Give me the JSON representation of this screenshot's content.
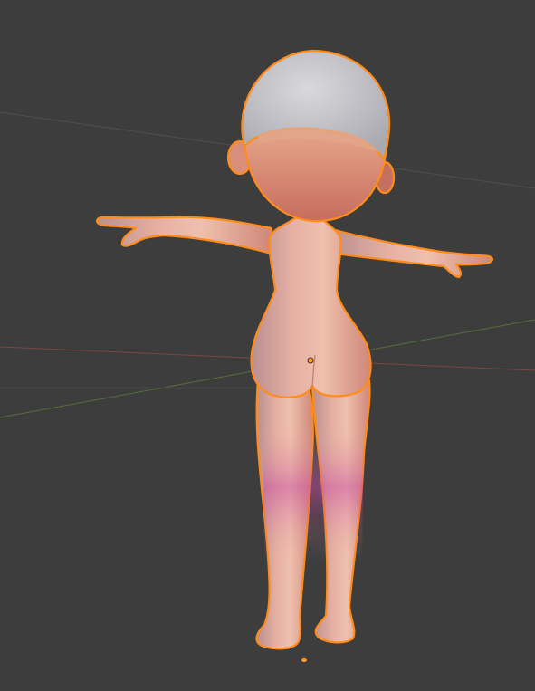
{
  "viewport": {
    "background": "#3d3d3d",
    "axis_colors": {
      "x_axis": "#8a4a4a",
      "y_axis": "#5f7a3e",
      "grid": "#4a4a4a"
    }
  },
  "model": {
    "selected": true,
    "outline_color": "#ff8c1a",
    "skin_base": "#e9b3a3",
    "skin_shadow": "#c06f6a",
    "hair_color": "#cfcfd3",
    "accent_tint": "#c44aa0"
  },
  "origin": {
    "color": "#ffa53a"
  }
}
